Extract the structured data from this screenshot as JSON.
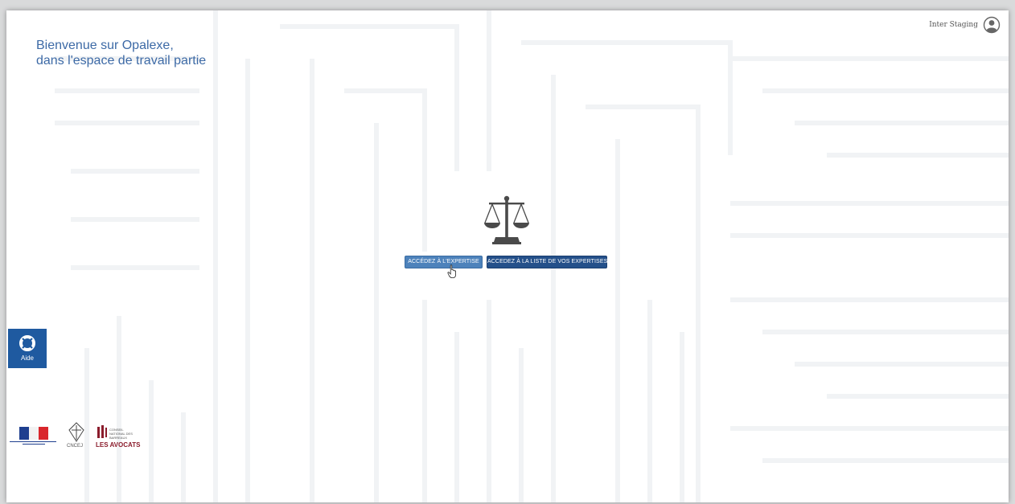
{
  "header": {
    "welcome_line1": "Bienvenue sur Opalexe,",
    "welcome_line2": "dans l'espace de travail partie",
    "user_name": "Inter Staging"
  },
  "main": {
    "access_button": "ACCÉDEZ À L'EXPERTISE",
    "list_button": "ACCEDEZ À LA LISTE DE VOS EXPERTISES"
  },
  "help": {
    "label": "Aide"
  },
  "logos": {
    "cnccj_label": "CNCEJ",
    "cnb_label": "CONSEIL NATIONAL DES BARREAUX",
    "avocats_label": "LES AVOCATS"
  },
  "colors": {
    "accent": "#3d6aa6",
    "help_bg": "#1f5aa0",
    "button_primary": "#4d82bb",
    "button_secondary": "#24508a"
  }
}
